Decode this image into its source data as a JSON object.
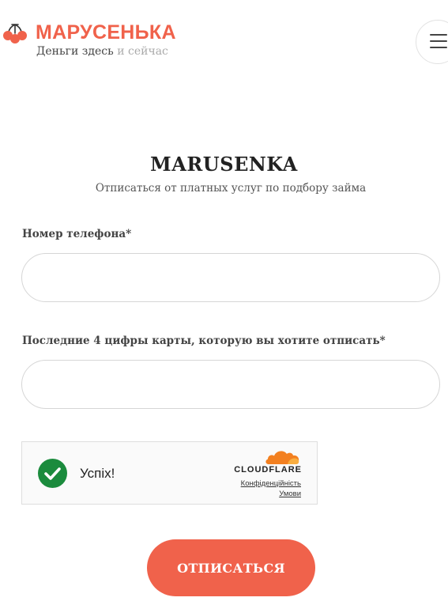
{
  "header": {
    "brand": "МАРУСЕНЬКА",
    "tagline_main": "Деньги здесь",
    "tagline_muted": "и сейчас",
    "logo_icon": "rowan-berries-icon",
    "menu_icon": "hamburger-menu-icon"
  },
  "main": {
    "title": "MARUSENKA",
    "subtitle": "Отписаться от платных услуг по подбору займа"
  },
  "form": {
    "phone_label": "Номер телефона*",
    "phone_value": "",
    "card_label": "Последние 4 цифры карты, которую вы хотите отписать*",
    "card_value": "",
    "submit_label": "ОТПИСАТЬСЯ"
  },
  "captcha": {
    "status": "Успіх!",
    "provider": "CLOUDFLARE",
    "privacy_link": "Конфіденційність",
    "terms_link": "Умови",
    "status_icon": "check-icon",
    "provider_icon": "cloudflare-cloud-icon"
  },
  "colors": {
    "accent": "#f0624b",
    "success": "#1b8b3d",
    "cloudflare": "#f38020"
  }
}
